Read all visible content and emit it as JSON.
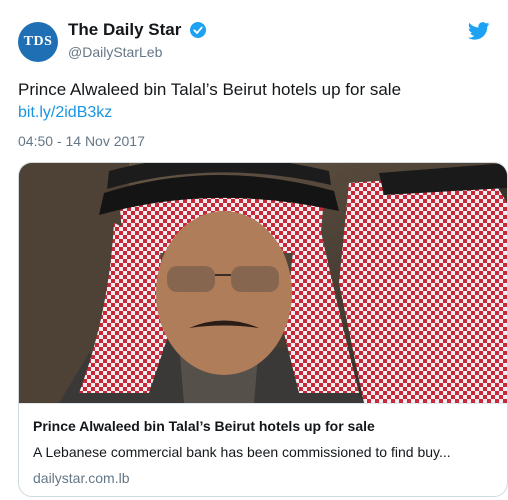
{
  "account": {
    "display_name": "The Daily Star",
    "handle": "@DailyStarLeb",
    "avatar_text": "TDS",
    "avatar_color": "#1f6fb5"
  },
  "tweet": {
    "text": "Prince Alwaleed bin Talal’s Beirut hotels up for sale",
    "link": "bit.ly/2idB3kz",
    "timestamp": "04:50 - 14 Nov 2017"
  },
  "card": {
    "image_icon": "photo-of-man-in-red-white-keffiyeh",
    "title": "Prince Alwaleed bin Talal’s Beirut hotels up for sale",
    "description": "A Lebanese commercial bank has been commissioned to find buy...",
    "domain": "dailystar.com.lb"
  },
  "colors": {
    "link": "#1b95e0",
    "verified": "#1da1f2",
    "twitter": "#1da1f2",
    "secondary_text": "#657786"
  }
}
